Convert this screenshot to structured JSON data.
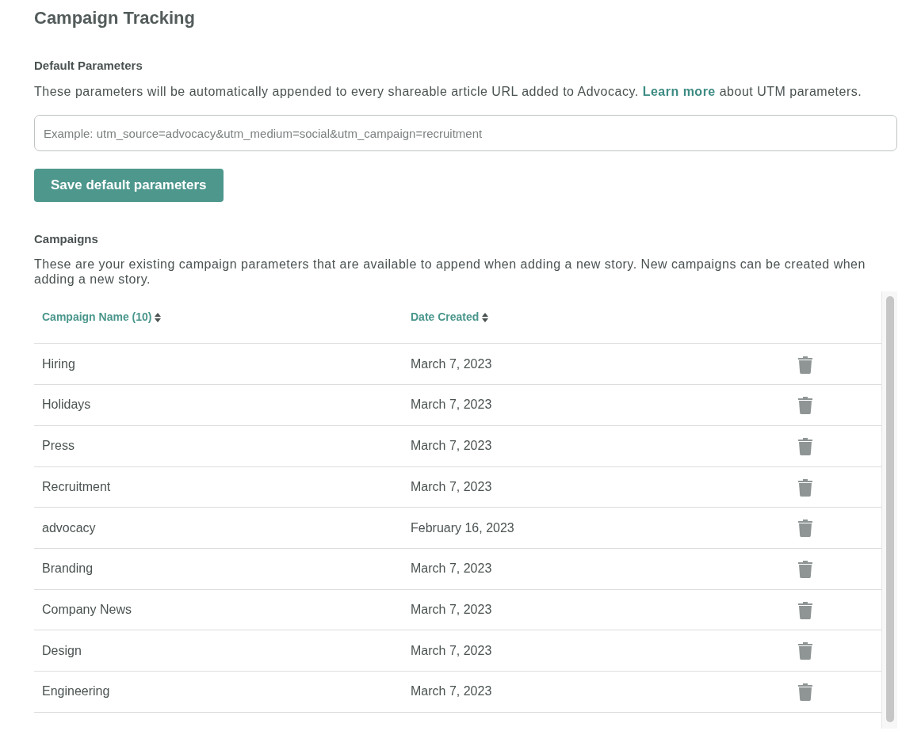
{
  "title": "Campaign Tracking",
  "default_parameters": {
    "heading": "Default Parameters",
    "description_before": "These parameters will be automatically appended to every shareable article URL added to Advocacy.",
    "link": "Learn more",
    "description_after": "about UTM parameters.",
    "field": {
      "placeholder": "Example: utm_source=advocacy&utm_medium=social&utm_campaign=recruitment"
    },
    "button": "Save default parameters"
  },
  "campaigns": {
    "heading": "Campaigns",
    "description": "These are your existing campaign parameters that are available to append when adding a new story. New campaigns can be created when adding a new story.",
    "table": {
      "columns": [
        {
          "label": "Campaign Name (10)",
          "sortable": true
        },
        {
          "label": "Date Created",
          "sortable": true
        }
      ],
      "rows": [
        {
          "name": "Hiring",
          "date": "March 7, 2023"
        },
        {
          "name": "Holidays",
          "date": "March 7, 2023"
        },
        {
          "name": "Press",
          "date": "March 7, 2023"
        },
        {
          "name": "Recruitment",
          "date": "March 7, 2023"
        },
        {
          "name": "advocacy",
          "date": "February 16, 2023"
        },
        {
          "name": "Branding",
          "date": "March 7, 2023"
        },
        {
          "name": "Company News",
          "date": "March 7, 2023"
        },
        {
          "name": "Design",
          "date": "March 7, 2023"
        },
        {
          "name": "Engineering",
          "date": "March 7, 2023"
        }
      ]
    }
  }
}
